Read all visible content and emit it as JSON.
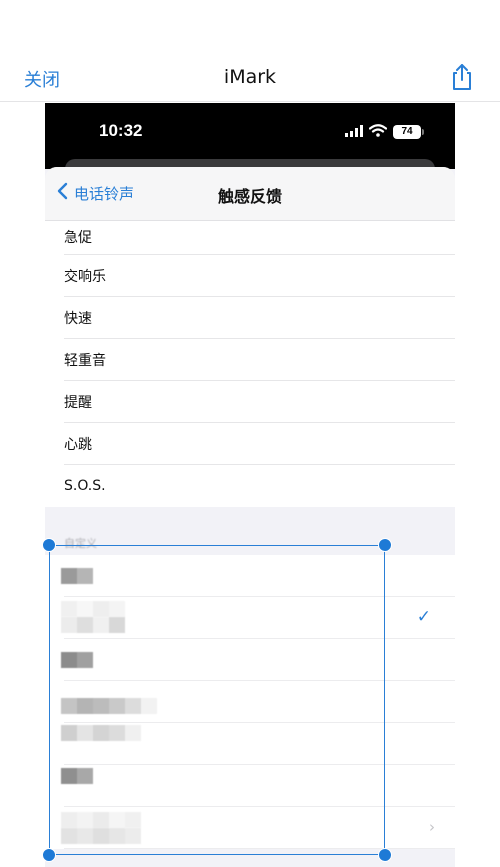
{
  "app_header": {
    "close_label": "关闭",
    "title": "iMark",
    "share_icon": "share-icon"
  },
  "status_bar": {
    "time": "10:32",
    "battery": "74"
  },
  "nav": {
    "back_label": "电话铃声",
    "title": "触感反馈"
  },
  "haptics": {
    "items": [
      {
        "label": "急促"
      },
      {
        "label": "交响乐"
      },
      {
        "label": "快速"
      },
      {
        "label": "轻重音"
      },
      {
        "label": "提醒"
      },
      {
        "label": "心跳"
      },
      {
        "label": "S.O.S."
      }
    ]
  },
  "custom_section": {
    "header": "自定义"
  },
  "colors": {
    "accent": "#2a7fd6",
    "selection_handle": "#1e7ad6",
    "separator": "#e6e6e8",
    "grouped_background": "#f2f2f7"
  }
}
